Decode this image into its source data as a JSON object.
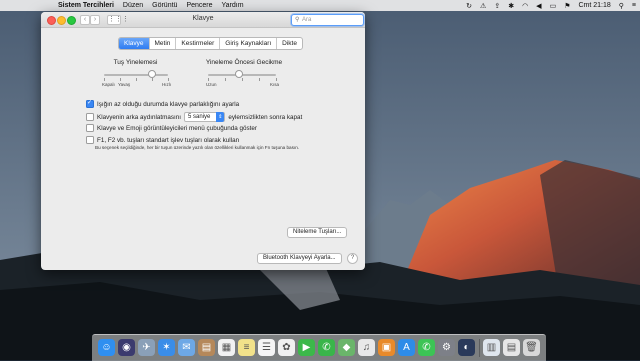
{
  "menubar": {
    "apple": "",
    "app_name": "Sistem Tercihleri",
    "items": [
      "Düzen",
      "Görüntü",
      "Pencere",
      "Yardım"
    ],
    "clock": "Cmt 21:18",
    "status_icons": [
      "sync-icon",
      "alert-icon",
      "upload-icon",
      "bluetooth-icon",
      "wifi-icon",
      "volume-icon",
      "battery-icon",
      "flag-icon"
    ]
  },
  "window": {
    "title": "Klavye",
    "search_placeholder": "Ara",
    "tabs": [
      {
        "label": "Klavye",
        "active": true
      },
      {
        "label": "Metin",
        "active": false
      },
      {
        "label": "Kestirmeler",
        "active": false
      },
      {
        "label": "Giriş Kaynakları",
        "active": false
      },
      {
        "label": "Dikte",
        "active": false
      }
    ],
    "key_repeat": {
      "title": "Tuş Yinelemesi",
      "labels": [
        "Kapalı",
        "Yavaş",
        "Hızlı"
      ],
      "value_fraction": 0.75
    },
    "delay_until_repeat": {
      "title": "Yineleme Öncesi Gecikme",
      "labels": [
        "Uzun",
        "Kısa"
      ],
      "value_fraction": 0.45
    },
    "options": {
      "brightness": {
        "label": "Işığın az olduğu durumda klavye parlaklığını ayarla",
        "checked": true
      },
      "backlight_pre": "Klavyenin arka aydınlatmasını",
      "backlight_value": "5 saniye",
      "backlight_post": "eylemsizlikten sonra kapat",
      "backlight_checked": false,
      "emoji_viewer": {
        "label": "Klavye ve Emoji görüntüleyicileri menü çubuğunda göster",
        "checked": false
      },
      "fn_keys": {
        "label": "F1, F2 vb. tuşları standart işlev tuşları olarak kullan",
        "checked": false
      },
      "fn_note": "Bu seçenek seçildiğinde, her bir tuşun üzerinde yazılı olan özellikleri kullanmak için Fn tuşuna basın."
    },
    "modifier_button": "Niteleme Tuşları...",
    "bluetooth_button": "Bluetooth Klavyeyi Ayarla...",
    "help_button": "?"
  },
  "dock": {
    "apps": [
      {
        "name": "finder",
        "color": "#2f8ff0",
        "glyph": "☺"
      },
      {
        "name": "siri",
        "color": "#3b3b6e",
        "glyph": "◉"
      },
      {
        "name": "launchpad",
        "color": "#8aa0b8",
        "glyph": "✈"
      },
      {
        "name": "safari",
        "color": "#3a8de8",
        "glyph": "✶"
      },
      {
        "name": "mail",
        "color": "#6da8e6",
        "glyph": "✉"
      },
      {
        "name": "contacts",
        "color": "#b5885a",
        "glyph": "▤"
      },
      {
        "name": "calendar",
        "color": "#f2f2f2",
        "glyph": "▦"
      },
      {
        "name": "notes",
        "color": "#f2e28a",
        "glyph": "≡"
      },
      {
        "name": "reminders",
        "color": "#f5f5f5",
        "glyph": "☰"
      },
      {
        "name": "photos",
        "color": "#f0f0f0",
        "glyph": "✿"
      },
      {
        "name": "facetime",
        "color": "#3cb84a",
        "glyph": "▶"
      },
      {
        "name": "messages",
        "color": "#39b54a",
        "glyph": "✆"
      },
      {
        "name": "maps",
        "color": "#6ab56a",
        "glyph": "◆"
      },
      {
        "name": "itunes",
        "color": "#e8e8e8",
        "glyph": "♫"
      },
      {
        "name": "ibooks",
        "color": "#e88a2a",
        "glyph": "▣"
      },
      {
        "name": "app-store",
        "color": "#2e8ce8",
        "glyph": "A"
      },
      {
        "name": "whatsapp",
        "color": "#3cc455",
        "glyph": "✆"
      },
      {
        "name": "system-preferences",
        "color": "#7d8088",
        "glyph": "⚙"
      },
      {
        "name": "quicktime",
        "color": "#2a3a5a",
        "glyph": "◐"
      },
      {
        "name": "downloads",
        "color": "#dfe6ee",
        "glyph": "▥"
      },
      {
        "name": "documents",
        "color": "#e6e6e6",
        "glyph": "▤"
      },
      {
        "name": "trash",
        "color": "#d8d8d8",
        "glyph": "🗑"
      }
    ]
  }
}
